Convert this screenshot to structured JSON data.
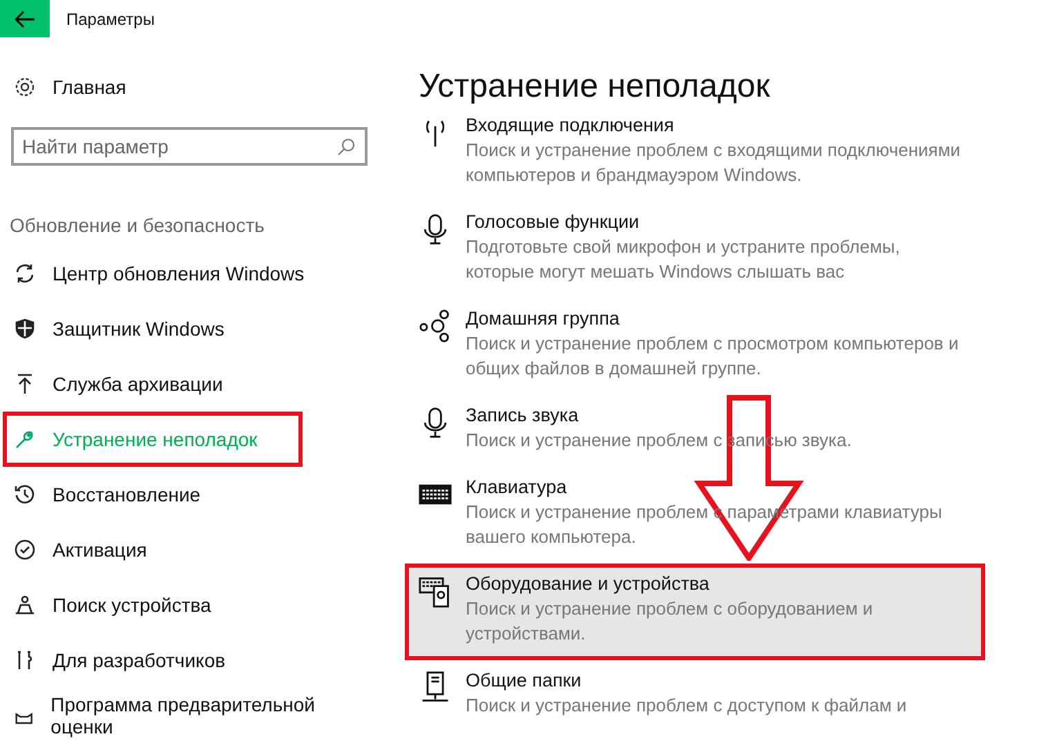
{
  "window": {
    "title": "Параметры"
  },
  "sidebar": {
    "home": "Главная",
    "search": {
      "placeholder": "Найти параметр"
    },
    "section": "Обновление и безопасность",
    "items": [
      {
        "label": "Центр обновления Windows",
        "selected": false,
        "annotated": false
      },
      {
        "label": "Защитник Windows",
        "selected": false,
        "annotated": false
      },
      {
        "label": "Служба архивации",
        "selected": false,
        "annotated": false
      },
      {
        "label": "Устранение неполадок",
        "selected": true,
        "annotated": true
      },
      {
        "label": "Восстановление",
        "selected": false,
        "annotated": false
      },
      {
        "label": "Активация",
        "selected": false,
        "annotated": false
      },
      {
        "label": "Поиск устройства",
        "selected": false,
        "annotated": false
      },
      {
        "label": "Для разработчиков",
        "selected": false,
        "annotated": false
      },
      {
        "label": "Программа предварительной оценки",
        "selected": false,
        "annotated": false
      }
    ]
  },
  "content": {
    "title": "Устранение неполадок",
    "items": [
      {
        "title": "Входящие подключения",
        "description": "Поиск и устранение проблем с входящими подключениями компьютеров и брандмауэром Windows.",
        "highlighted": false,
        "annotated": false
      },
      {
        "title": "Голосовые функции",
        "description": "Подготовьте свой микрофон и устраните проблемы, которые могут мешать Windows слышать вас",
        "highlighted": false,
        "annotated": false
      },
      {
        "title": "Домашняя группа",
        "description": "Поиск и устранение проблем с просмотром компьютеров и общих файлов в домашней группе.",
        "highlighted": false,
        "annotated": false
      },
      {
        "title": "Запись звука",
        "description": "Поиск и устранение проблем с записью звука.",
        "highlighted": false,
        "annotated": false
      },
      {
        "title": "Клавиатура",
        "description": "Поиск и устранение проблем с параметрами клавиатуры вашего компьютера.",
        "highlighted": false,
        "annotated": false
      },
      {
        "title": "Оборудование и устройства",
        "description": "Поиск и устранение проблем с оборудованием и устройствами.",
        "highlighted": true,
        "annotated": true
      },
      {
        "title": "Общие папки",
        "description": "Поиск и устранение проблем с доступом к файлам и",
        "highlighted": false,
        "annotated": false
      }
    ]
  }
}
